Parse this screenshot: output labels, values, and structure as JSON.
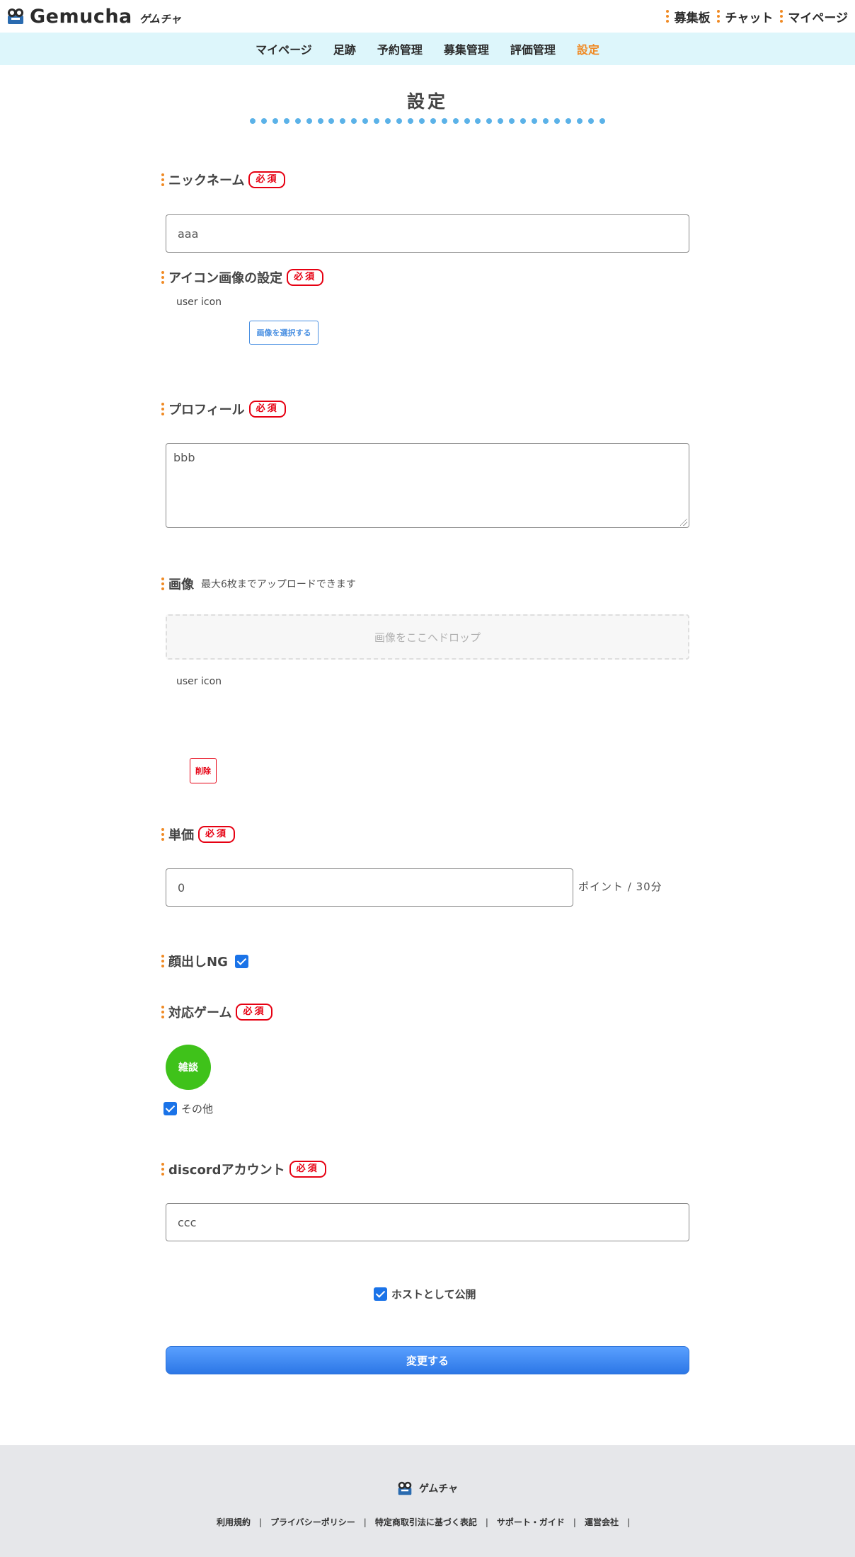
{
  "header": {
    "logo_word": "Gemucha",
    "logo_kana": "ゲムチャ",
    "links": [
      "募集板",
      "チャット",
      "マイページ"
    ]
  },
  "subnav": {
    "items": [
      "マイページ",
      "足跡",
      "予約管理",
      "募集管理",
      "評価管理",
      "設定"
    ],
    "active": "設定"
  },
  "page": {
    "title": "設定"
  },
  "required_badge": "必須",
  "form": {
    "nickname": {
      "label": "ニックネーム",
      "value": "aaa"
    },
    "icon": {
      "label": "アイコン画像の設定",
      "alt": "user icon",
      "select_button": "画像を選択する"
    },
    "profile": {
      "label": "プロフィール",
      "value": "bbb"
    },
    "images": {
      "label": "画像",
      "note": "最大6枚までアップロードできます",
      "dropzone": "画像をここへドロップ",
      "alt": "user icon",
      "delete_button": "削除"
    },
    "price": {
      "label": "単価",
      "value": "0",
      "unit": "ポイント / 30分"
    },
    "face_ng": {
      "label": "顔出しNG",
      "checked": true
    },
    "games": {
      "label": "対応ゲーム",
      "chip": "雑談",
      "other_label": "その他",
      "other_checked": true
    },
    "discord": {
      "label": "discordアカウント",
      "value": "ccc"
    },
    "publish": {
      "label": "ホストとして公開",
      "checked": true
    },
    "submit": "変更する"
  },
  "footer": {
    "logo_kana": "ゲムチャ",
    "links": [
      "利用規約",
      "プライバシーポリシー",
      "特定商取引法に基づく表記",
      "サポート・ガイド",
      "運営会社"
    ]
  },
  "colors": {
    "accent": "#f08a24",
    "subnav_bg": "#ddf6fb",
    "required": "#e60012",
    "primary": "#2c77e6",
    "game_chip": "#3fc21a",
    "footer_bg": "#e6e7ea"
  }
}
